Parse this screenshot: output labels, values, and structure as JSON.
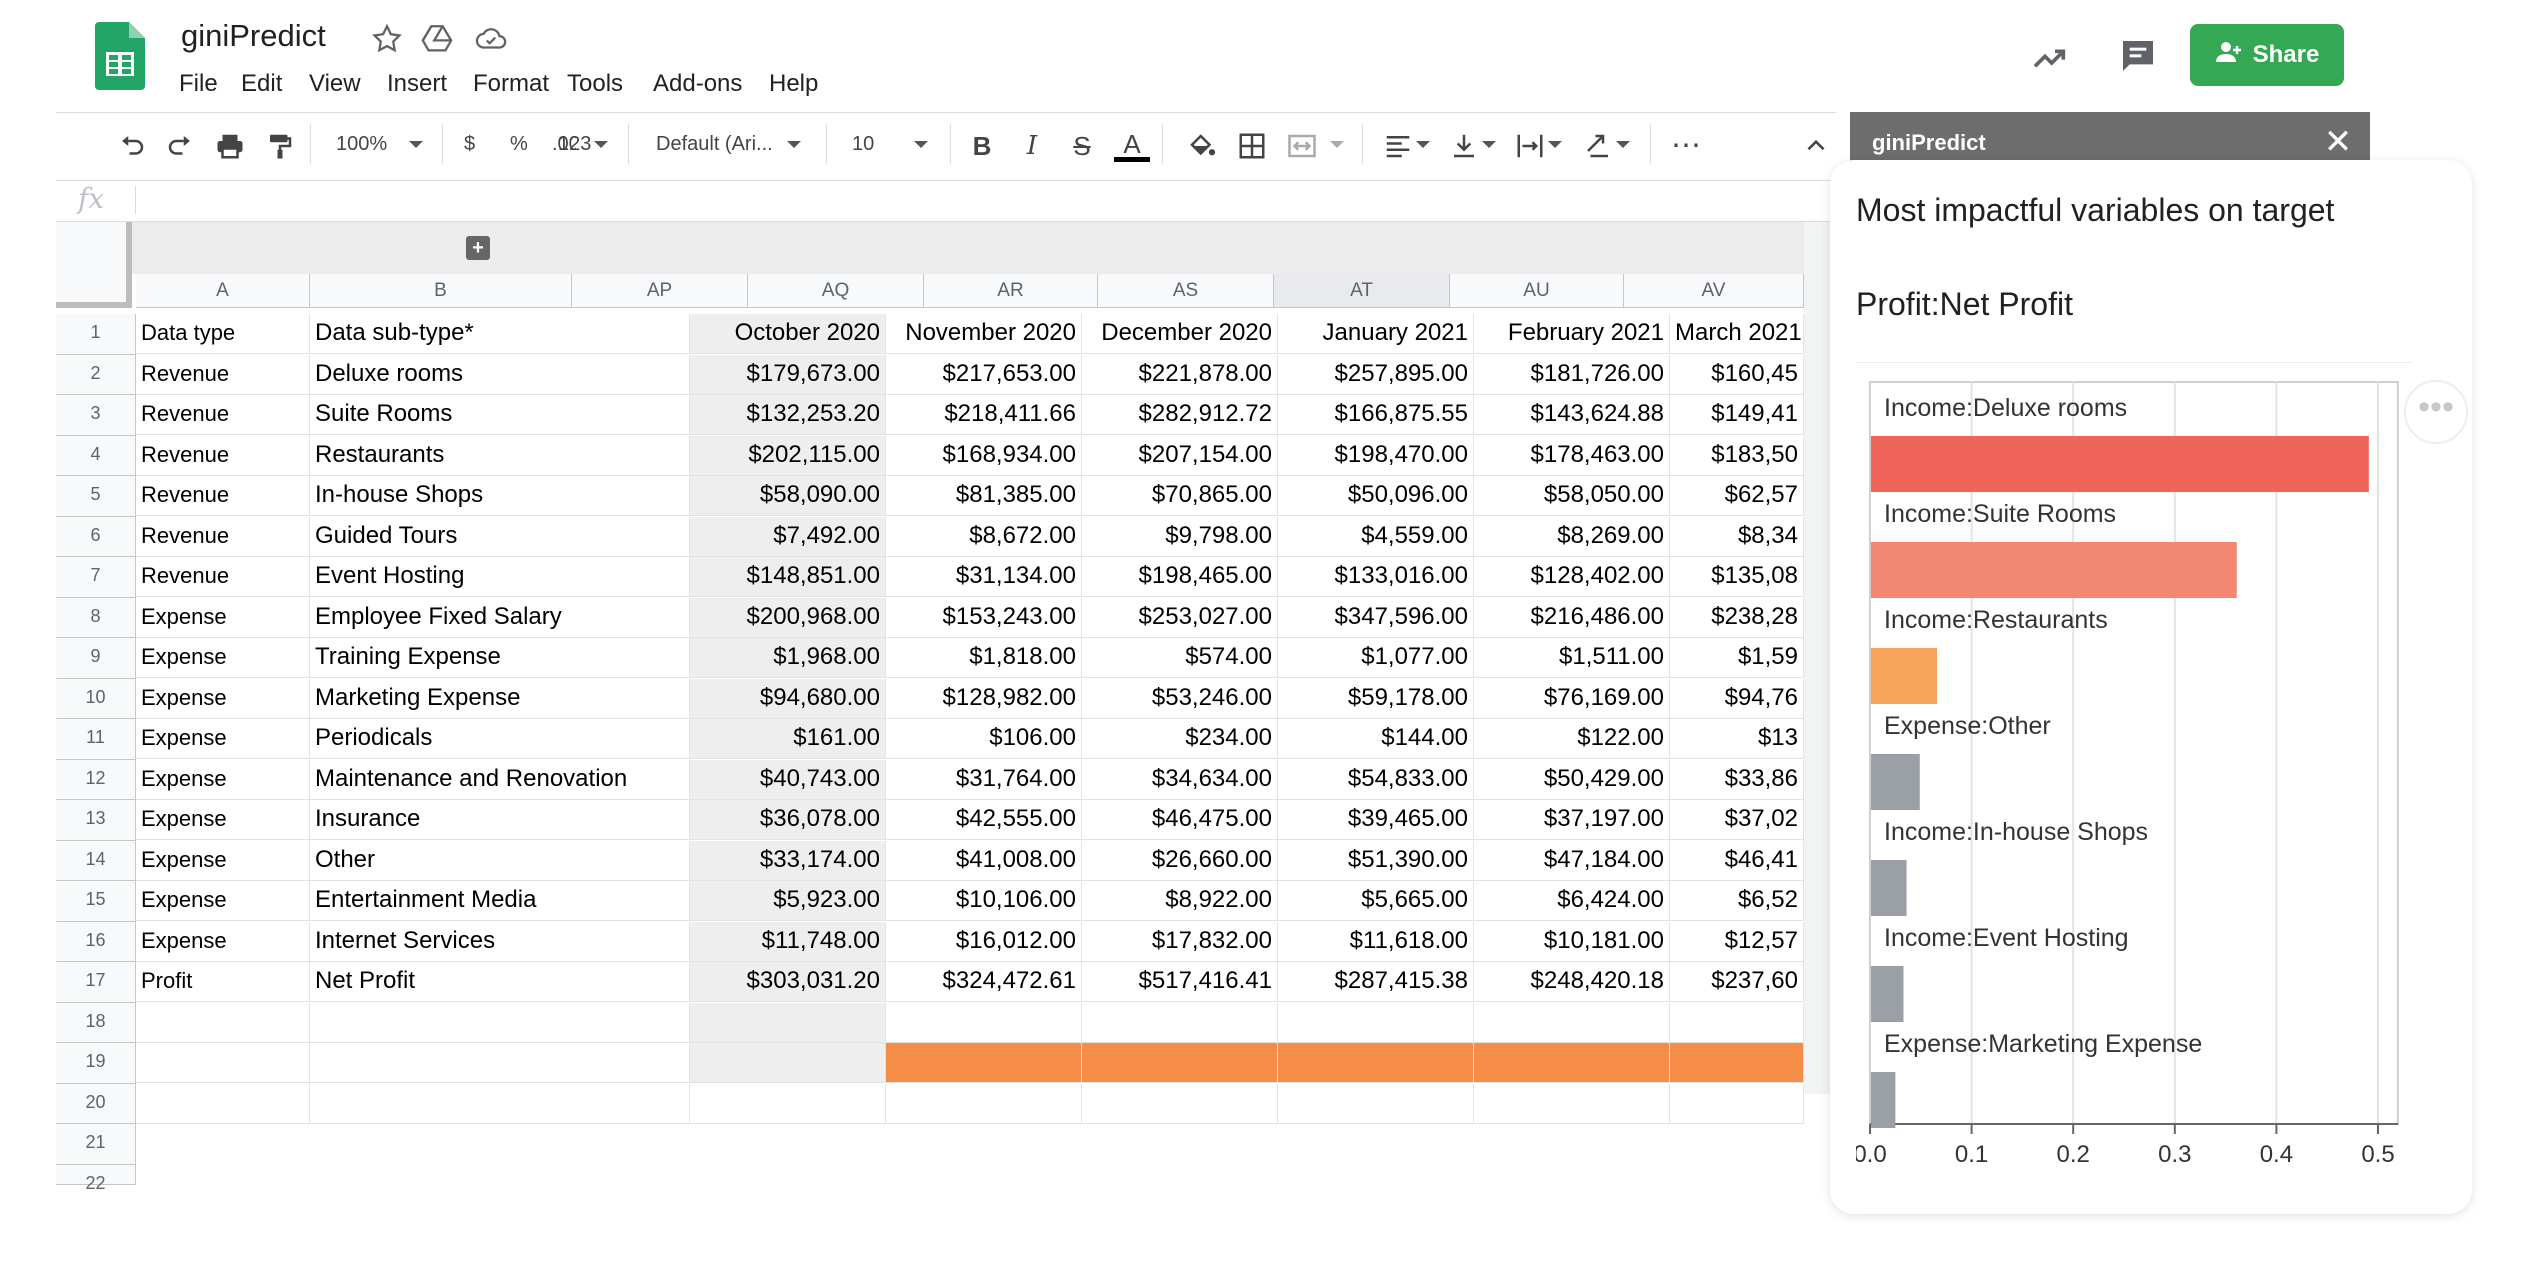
{
  "header": {
    "title": "giniPredict",
    "menu": [
      "File",
      "Edit",
      "View",
      "Insert",
      "Format",
      "Tools",
      "Add-ons",
      "Help"
    ],
    "share_label": "Share"
  },
  "toolbar": {
    "zoom": "100%",
    "currency": "$",
    "percent": "%",
    "decimal": ".00",
    "more_formats": "123",
    "font": "Default (Ari...",
    "font_size": "10"
  },
  "formula": {
    "fx": "fx",
    "value": ""
  },
  "grid": {
    "columns": [
      "A",
      "B",
      "AP",
      "AQ",
      "AR",
      "AS",
      "AT",
      "AU",
      "AV"
    ],
    "row_numbers": [
      "1",
      "2",
      "3",
      "4",
      "5",
      "6",
      "7",
      "8",
      "9",
      "10",
      "11",
      "12",
      "13",
      "14",
      "15",
      "16",
      "17",
      "18",
      "19",
      "20",
      "21",
      "22"
    ],
    "header_row": [
      "Data type",
      "Data sub-type*",
      "October 2020",
      "November 2020",
      "December 2020",
      "January 2021",
      "February 2021",
      "March 2021"
    ],
    "rows": [
      [
        "Revenue",
        "Deluxe rooms",
        "$179,673.00",
        "$217,653.00",
        "$221,878.00",
        "$257,895.00",
        "$181,726.00",
        "$160,45"
      ],
      [
        "Revenue",
        "Suite Rooms",
        "$132,253.20",
        "$218,411.66",
        "$282,912.72",
        "$166,875.55",
        "$143,624.88",
        "$149,41"
      ],
      [
        "Revenue",
        "Restaurants",
        "$202,115.00",
        "$168,934.00",
        "$207,154.00",
        "$198,470.00",
        "$178,463.00",
        "$183,50"
      ],
      [
        "Revenue",
        "In-house Shops",
        "$58,090.00",
        "$81,385.00",
        "$70,865.00",
        "$50,096.00",
        "$58,050.00",
        "$62,57"
      ],
      [
        "Revenue",
        "Guided Tours",
        "$7,492.00",
        "$8,672.00",
        "$9,798.00",
        "$4,559.00",
        "$8,269.00",
        "$8,34"
      ],
      [
        "Revenue",
        "Event Hosting",
        "$148,851.00",
        "$31,134.00",
        "$198,465.00",
        "$133,016.00",
        "$128,402.00",
        "$135,08"
      ],
      [
        "Expense",
        "Employee Fixed Salary",
        "$200,968.00",
        "$153,243.00",
        "$253,027.00",
        "$347,596.00",
        "$216,486.00",
        "$238,28"
      ],
      [
        "Expense",
        "Training Expense",
        "$1,968.00",
        "$1,818.00",
        "$574.00",
        "$1,077.00",
        "$1,511.00",
        "$1,59"
      ],
      [
        "Expense",
        "Marketing Expense",
        "$94,680.00",
        "$128,982.00",
        "$53,246.00",
        "$59,178.00",
        "$76,169.00",
        "$94,76"
      ],
      [
        "Expense",
        "Periodicals",
        "$161.00",
        "$106.00",
        "$234.00",
        "$144.00",
        "$122.00",
        "$13"
      ],
      [
        "Expense",
        "Maintenance and Renovation",
        "$40,743.00",
        "$31,764.00",
        "$34,634.00",
        "$54,833.00",
        "$50,429.00",
        "$33,86"
      ],
      [
        "Expense",
        "Insurance",
        "$36,078.00",
        "$42,555.00",
        "$46,475.00",
        "$39,465.00",
        "$37,197.00",
        "$37,02"
      ],
      [
        "Expense",
        "Other",
        "$33,174.00",
        "$41,008.00",
        "$26,660.00",
        "$51,390.00",
        "$47,184.00",
        "$46,41"
      ],
      [
        "Expense",
        "Entertainment Media",
        "$5,923.00",
        "$10,106.00",
        "$8,922.00",
        "$5,665.00",
        "$6,424.00",
        "$6,52"
      ],
      [
        "Expense",
        "Internet Services",
        "$11,748.00",
        "$16,012.00",
        "$17,832.00",
        "$11,618.00",
        "$10,181.00",
        "$12,57"
      ],
      [
        "Profit",
        "Net Profit",
        "$303,031.20",
        "$324,472.61",
        "$517,416.41",
        "$287,415.38",
        "$248,420.18",
        "$237,60"
      ]
    ]
  },
  "panel": {
    "title": "giniPredict",
    "heading": "Most impactful variables on target",
    "target": "Profit:Net Profit"
  },
  "chart_data": {
    "type": "bar",
    "orientation": "horizontal",
    "categories": [
      "Income:Deluxe rooms",
      "Income:Suite Rooms",
      "Income:Restaurants",
      "Expense:Other",
      "Income:In-house Shops",
      "Income:Event Hosting",
      "Expense:Marketing Expense"
    ],
    "values": [
      0.49,
      0.36,
      0.065,
      0.048,
      0.035,
      0.032,
      0.024
    ],
    "colors": [
      "#f0645a",
      "#f28872",
      "#f6a35c",
      "#9aa0a6",
      "#9aa0a6",
      "#9aa0a6",
      "#9aa0a6"
    ],
    "xlim": [
      0,
      0.5
    ],
    "xticks": [
      "0.0",
      "0.1",
      "0.2",
      "0.3",
      "0.4",
      "0.5"
    ],
    "grid": true,
    "title": "",
    "xlabel": "",
    "ylabel": ""
  },
  "colors": {
    "share_green": "#34a853",
    "highlight_orange": "#f68d47",
    "panel_header": "#6d6d6d"
  }
}
